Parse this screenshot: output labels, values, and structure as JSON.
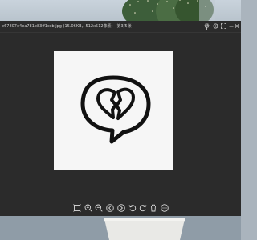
{
  "window": {
    "title": "e67807e4ea781e83ff1ccb.jpg (15.06KB，512x512像素) - 第3/5张"
  },
  "titlebar_buttons": [
    {
      "name": "pin-button",
      "icon": "pin-icon"
    },
    {
      "name": "settings-button",
      "icon": "gear-icon"
    },
    {
      "name": "fullscreen-button",
      "icon": "fullscreen-icon"
    },
    {
      "name": "minimize-button",
      "icon": "minimize-icon"
    },
    {
      "name": "maximize-button",
      "icon": "maximize-icon"
    },
    {
      "name": "close-button",
      "icon": "close-icon"
    }
  ],
  "image": {
    "content": "broken-heart-speech-bubble-icon",
    "background_color": "#f6f6f6",
    "stroke_color": "#111111"
  },
  "toolbar": [
    {
      "name": "fit-window-button",
      "icon": "fit-icon"
    },
    {
      "name": "zoom-in-button",
      "icon": "zoom-in-icon"
    },
    {
      "name": "zoom-out-button",
      "icon": "zoom-out-icon"
    },
    {
      "name": "previous-button",
      "icon": "chevron-left-icon"
    },
    {
      "name": "next-button",
      "icon": "chevron-right-icon"
    },
    {
      "name": "rotate-left-button",
      "icon": "rotate-left-icon"
    },
    {
      "name": "rotate-right-button",
      "icon": "rotate-right-icon"
    },
    {
      "name": "delete-button",
      "icon": "trash-icon"
    },
    {
      "name": "more-button",
      "icon": "more-icon"
    }
  ],
  "colors": {
    "window_bg": "#2b2b2b",
    "icon": "#d9d9d9",
    "title_text": "#cfcfcf"
  }
}
